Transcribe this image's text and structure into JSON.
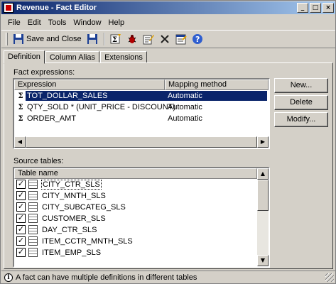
{
  "window": {
    "title": "Revenue - Fact Editor"
  },
  "menu": [
    "File",
    "Edit",
    "Tools",
    "Window",
    "Help"
  ],
  "toolbar": {
    "save_close_label": "Save and Close"
  },
  "tabs": [
    "Definition",
    "Column Alias",
    "Extensions"
  ],
  "fact_expressions": {
    "label": "Fact expressions:",
    "columns": [
      "Expression",
      "Mapping method"
    ],
    "rows": [
      {
        "expression": "TOT_DOLLAR_SALES",
        "mapping": "Automatic"
      },
      {
        "expression": "QTY_SOLD * (UNIT_PRICE - DISCOUNT)",
        "mapping": "Automatic"
      },
      {
        "expression": "ORDER_AMT",
        "mapping": "Automatic"
      }
    ]
  },
  "buttons": {
    "new": "New...",
    "delete": "Delete",
    "modify": "Modify..."
  },
  "source_tables": {
    "label": "Source tables:",
    "column": "Table name",
    "rows": [
      "CITY_CTR_SLS",
      "CITY_MNTH_SLS",
      "CITY_SUBCATEG_SLS",
      "CUSTOMER_SLS",
      "DAY_CTR_SLS",
      "ITEM_CCTR_MNTH_SLS",
      "ITEM_EMP_SLS"
    ]
  },
  "status": {
    "text": "A fact can have multiple definitions in different tables"
  }
}
